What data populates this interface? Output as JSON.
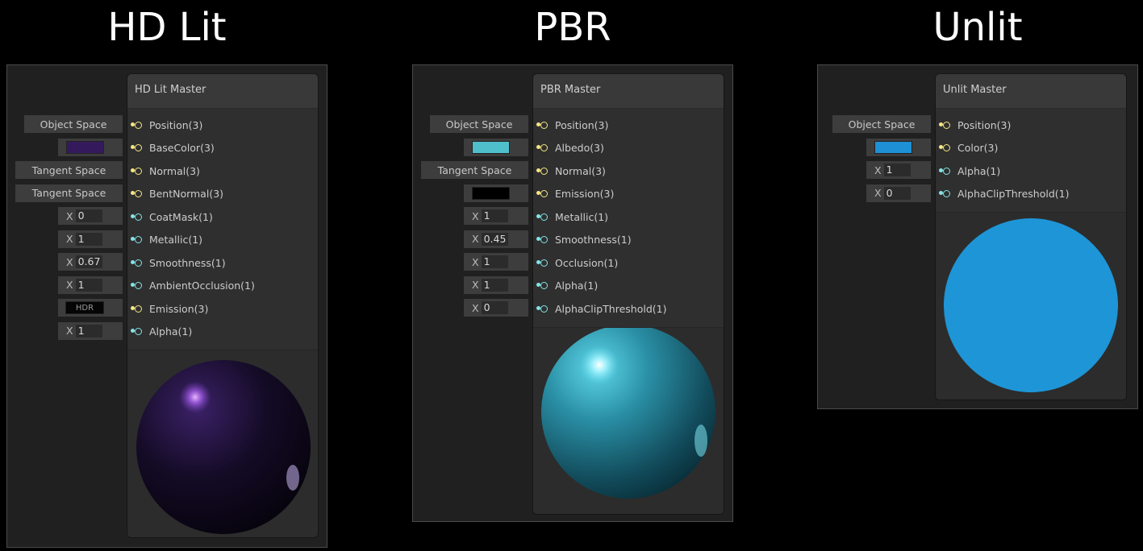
{
  "hdlit": {
    "heading": "HD Lit",
    "title": "HD Lit Master",
    "ports": [
      {
        "label": "Position(3)",
        "kind": "vec"
      },
      {
        "label": "BaseColor(3)",
        "kind": "vec"
      },
      {
        "label": "Normal(3)",
        "kind": "vec"
      },
      {
        "label": "BentNormal(3)",
        "kind": "vec"
      },
      {
        "label": "CoatMask(1)",
        "kind": "float"
      },
      {
        "label": "Metallic(1)",
        "kind": "float"
      },
      {
        "label": "Smoothness(1)",
        "kind": "float"
      },
      {
        "label": "AmbientOcclusion(1)",
        "kind": "float"
      },
      {
        "label": "Emission(3)",
        "kind": "vec"
      },
      {
        "label": "Alpha(1)",
        "kind": "float"
      }
    ],
    "inputs": [
      {
        "type": "label",
        "text": "Object Space"
      },
      {
        "type": "color",
        "color": "#341a5c"
      },
      {
        "type": "label",
        "text": "Tangent Space"
      },
      {
        "type": "label",
        "text": "Tangent Space"
      },
      {
        "type": "x",
        "prefix": "X",
        "value": "0"
      },
      {
        "type": "x",
        "prefix": "X",
        "value": "1"
      },
      {
        "type": "x",
        "prefix": "X",
        "value": "0.67"
      },
      {
        "type": "x",
        "prefix": "X",
        "value": "1"
      },
      {
        "type": "hdr",
        "text": "HDR"
      },
      {
        "type": "x",
        "prefix": "X",
        "value": "1"
      }
    ]
  },
  "pbr": {
    "heading": "PBR",
    "title": "PBR Master",
    "ports": [
      {
        "label": "Position(3)",
        "kind": "vec"
      },
      {
        "label": "Albedo(3)",
        "kind": "vec"
      },
      {
        "label": "Normal(3)",
        "kind": "vec"
      },
      {
        "label": "Emission(3)",
        "kind": "vec"
      },
      {
        "label": "Metallic(1)",
        "kind": "float"
      },
      {
        "label": "Smoothness(1)",
        "kind": "float"
      },
      {
        "label": "Occlusion(1)",
        "kind": "float"
      },
      {
        "label": "Alpha(1)",
        "kind": "float"
      },
      {
        "label": "AlphaClipThreshold(1)",
        "kind": "float"
      }
    ],
    "inputs": [
      {
        "type": "label",
        "text": "Object Space"
      },
      {
        "type": "color",
        "color": "#4fbfcc"
      },
      {
        "type": "label",
        "text": "Tangent Space"
      },
      {
        "type": "color",
        "color": "#000000"
      },
      {
        "type": "x",
        "prefix": "X",
        "value": "1"
      },
      {
        "type": "x",
        "prefix": "X",
        "value": "0.45"
      },
      {
        "type": "x",
        "prefix": "X",
        "value": "1"
      },
      {
        "type": "x",
        "prefix": "X",
        "value": "1"
      },
      {
        "type": "x",
        "prefix": "X",
        "value": "0"
      }
    ]
  },
  "unlit": {
    "heading": "Unlit",
    "title": "Unlit Master",
    "ports": [
      {
        "label": "Position(3)",
        "kind": "vec"
      },
      {
        "label": "Color(3)",
        "kind": "vec"
      },
      {
        "label": "Alpha(1)",
        "kind": "float"
      },
      {
        "label": "AlphaClipThreshold(1)",
        "kind": "float"
      }
    ],
    "inputs": [
      {
        "type": "label",
        "text": "Object Space"
      },
      {
        "type": "color",
        "color": "#1e90d6"
      },
      {
        "type": "x",
        "prefix": "X",
        "value": "1"
      },
      {
        "type": "x",
        "prefix": "X",
        "value": "0"
      }
    ]
  },
  "colors": {
    "vec_port": "#f5e783",
    "float_port": "#84e4e7",
    "hdlit_sphere": "#6a3fb0",
    "pbr_sphere": "#2a8fa5",
    "unlit_sphere": "#1e95d6"
  }
}
